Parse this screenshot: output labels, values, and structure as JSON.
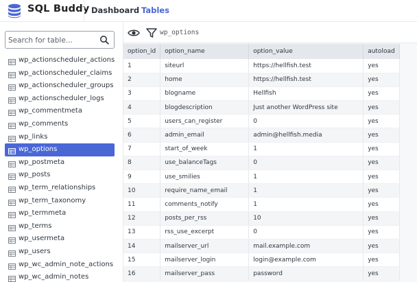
{
  "app": {
    "title": "SQL Buddy"
  },
  "nav": {
    "dashboard": "Dashboard",
    "tables": "Tables"
  },
  "sidebar": {
    "search_placeholder": "Search for table...",
    "tables": [
      "wp_actionscheduler_actions",
      "wp_actionscheduler_claims",
      "wp_actionscheduler_groups",
      "wp_actionscheduler_logs",
      "wp_commentmeta",
      "wp_comments",
      "wp_links",
      "wp_options",
      "wp_postmeta",
      "wp_posts",
      "wp_term_relationships",
      "wp_term_taxonomy",
      "wp_termmeta",
      "wp_terms",
      "wp_usermeta",
      "wp_users",
      "wp_wc_admin_note_actions",
      "wp_wc_admin_notes"
    ],
    "active_table": "wp_options"
  },
  "toolbar": {
    "table_name": "wp_options"
  },
  "grid": {
    "columns": [
      "option_id",
      "option_name",
      "option_value",
      "autoload"
    ],
    "rows": [
      [
        "1",
        "siteurl",
        "https://hellfish.test",
        "yes"
      ],
      [
        "2",
        "home",
        "https://hellfish.test",
        "yes"
      ],
      [
        "3",
        "blogname",
        "Hellfish",
        "yes"
      ],
      [
        "4",
        "blogdescription",
        "Just another WordPress site",
        "yes"
      ],
      [
        "5",
        "users_can_register",
        "0",
        "yes"
      ],
      [
        "6",
        "admin_email",
        "admin@hellfish.media",
        "yes"
      ],
      [
        "7",
        "start_of_week",
        "1",
        "yes"
      ],
      [
        "8",
        "use_balanceTags",
        "0",
        "yes"
      ],
      [
        "9",
        "use_smilies",
        "1",
        "yes"
      ],
      [
        "10",
        "require_name_email",
        "1",
        "yes"
      ],
      [
        "11",
        "comments_notify",
        "1",
        "yes"
      ],
      [
        "12",
        "posts_per_rss",
        "10",
        "yes"
      ],
      [
        "13",
        "rss_use_excerpt",
        "0",
        "yes"
      ],
      [
        "14",
        "mailserver_url",
        "mail.example.com",
        "yes"
      ],
      [
        "15",
        "mailserver_login",
        "login@example.com",
        "yes"
      ],
      [
        "16",
        "mailserver_pass",
        "password",
        "yes"
      ]
    ]
  },
  "colors": {
    "accent": "#4a67d6",
    "header_bg": "#e4e7ec"
  },
  "icons": {
    "logo": "database-icon",
    "search": "search-icon",
    "view": "eye-icon",
    "filter": "filter-icon",
    "table": "table-icon"
  }
}
